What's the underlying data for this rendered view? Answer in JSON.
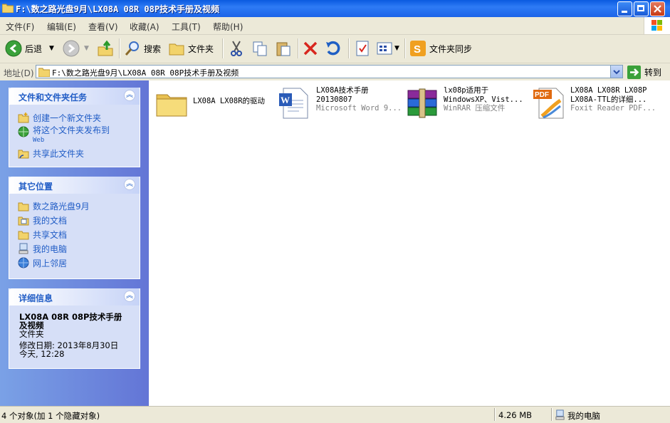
{
  "window": {
    "title": "F:\\数之路光盘9月\\LX08A 08R 08P技术手册及视频"
  },
  "menu": [
    "文件(F)",
    "编辑(E)",
    "查看(V)",
    "收藏(A)",
    "工具(T)",
    "帮助(H)"
  ],
  "toolbar": {
    "back": "后退",
    "search": "搜索",
    "folders": "文件夹",
    "sync": "文件夹同步"
  },
  "address": {
    "label": "地址(D)",
    "value": "F:\\数之路光盘9月\\LX08A 08R 08P技术手册及视频",
    "go": "转到"
  },
  "tasks": {
    "title": "文件和文件夹任务",
    "items": [
      "创建一个新文件夹",
      "将这个文件夹发布到",
      "共享此文件夹"
    ],
    "publish_sub": "Web"
  },
  "places": {
    "title": "其它位置",
    "items": [
      "数之路光盘9月",
      "我的文档",
      "共享文档",
      "我的电脑",
      "网上邻居"
    ]
  },
  "details": {
    "title": "详细信息",
    "name_line1": "LX08A 08R 08P技术手册",
    "name_line2": "及视频",
    "type": "文件夹",
    "modified_line1": "修改日期: 2013年8月30日",
    "modified_line2": "今天, 12:28"
  },
  "files": [
    {
      "lines": [
        "LX08A LX08R的驱动"
      ],
      "sub": "",
      "icon": "folder-icon"
    },
    {
      "lines": [
        "LX08A技术手册",
        "20130807"
      ],
      "sub": "Microsoft Word 9...",
      "icon": "word-doc-icon"
    },
    {
      "lines": [
        "lx08p适用于",
        "WindowsXP、Vist..."
      ],
      "sub": "WinRAR 压缩文件",
      "icon": "winrar-icon"
    },
    {
      "lines": [
        "LX08A LX08R LX08P",
        "LX08A-TTL的详细..."
      ],
      "sub": "Foxit Reader PDF...",
      "icon": "pdf-icon"
    }
  ],
  "status": {
    "objects": "4 个对象(加 1 个隐藏对象)",
    "size": "4.26 MB",
    "location": "我的电脑"
  }
}
